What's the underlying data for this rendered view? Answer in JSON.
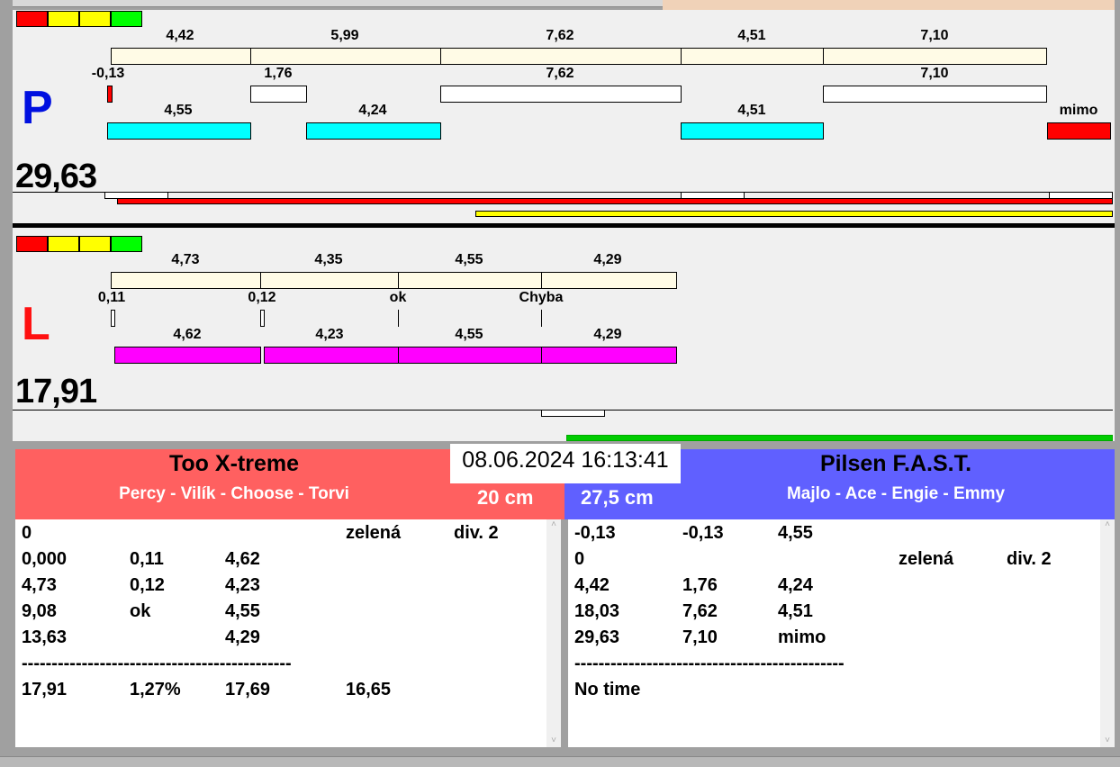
{
  "colors": {
    "red": "#ff0000",
    "yellow": "#ffff00",
    "green": "#00ff00",
    "cyan": "#00ffff",
    "magenta": "#ff00ff",
    "team_left": "#ff6060",
    "team_right": "#6060ff"
  },
  "p": {
    "side": "P",
    "total": "29,63",
    "row1": [
      "4,42",
      "5,99",
      "7,62",
      "4,51",
      "7,10"
    ],
    "row2": [
      "-0,13",
      "1,76",
      "7,62",
      "7,10"
    ],
    "row3": [
      "4,55",
      "4,24",
      "4,51",
      "mimo"
    ]
  },
  "l": {
    "side": "L",
    "total": "17,91",
    "row1": [
      "4,73",
      "4,35",
      "4,55",
      "4,29"
    ],
    "row2": [
      "0,11",
      "0,12",
      "ok",
      "Chyba"
    ],
    "row3": [
      "4,62",
      "4,23",
      "4,55",
      "4,29"
    ]
  },
  "datetime": "08.06.2024 16:13:41",
  "left_team": {
    "name": "Too X-treme",
    "members": "Percy - Vilík - Choose - Torvi",
    "height": "20 cm",
    "rows": [
      [
        "0",
        "",
        "",
        "zelená",
        "div. 2"
      ],
      [
        "0,000",
        "0,11",
        "4,62",
        "",
        ""
      ],
      [
        "4,73",
        "0,12",
        "4,23",
        "",
        ""
      ],
      [
        "9,08",
        "ok",
        "4,55",
        "",
        ""
      ],
      [
        "13,63",
        "",
        "4,29",
        "",
        ""
      ],
      [
        "---------------------------------------------",
        "",
        "",
        "",
        ""
      ],
      [
        "17,91",
        "1,27%",
        "17,69",
        "16,65",
        ""
      ]
    ]
  },
  "right_team": {
    "name": "Pilsen F.A.S.T.",
    "members": "Majlo - Ace - Engie - Emmy",
    "height": "27,5 cm",
    "rows": [
      [
        "-0,13",
        "-0,13",
        "4,55",
        "",
        ""
      ],
      [
        "0",
        "",
        "",
        "zelená",
        "div. 2"
      ],
      [
        "4,42",
        "1,76",
        "4,24",
        "",
        ""
      ],
      [
        "18,03",
        "7,62",
        "4,51",
        "",
        ""
      ],
      [
        "29,63",
        "7,10",
        "mimo",
        "",
        ""
      ],
      [
        "---------------------------------------------",
        "",
        "",
        "",
        ""
      ],
      [
        "No time",
        "",
        "",
        "",
        ""
      ]
    ]
  }
}
